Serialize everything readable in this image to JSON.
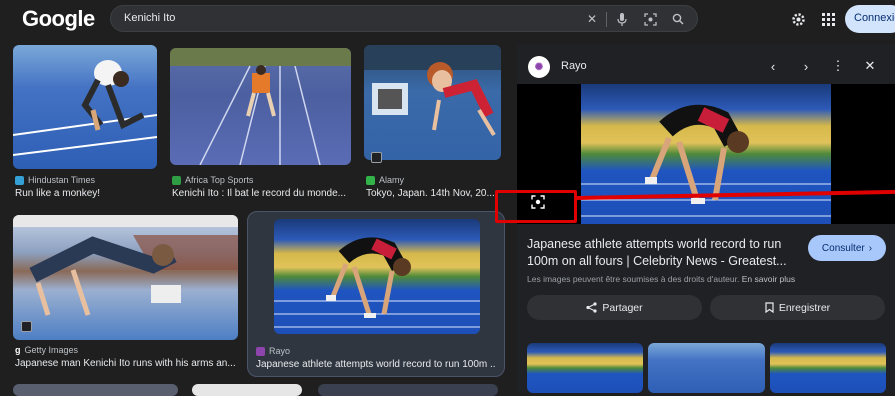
{
  "header": {
    "logo": "Google",
    "search_query": "Kenichi Ito",
    "connexion_label": "Connexio"
  },
  "results": [
    {
      "source": "Hindustan Times",
      "caption": "Run like a monkey!",
      "fav_color": "#34a0d6"
    },
    {
      "source": "Africa Top Sports",
      "caption": "Kenichi Ito : Il bat le record du monde...",
      "fav_color": "#2e9d44"
    },
    {
      "source": "Alamy",
      "caption": "Tokyo, Japan. 14th Nov, 20...",
      "fav_color": "#32b34a",
      "badge": "Story"
    },
    {
      "source": "Getty Images",
      "caption": "Japanese man Kenichi Ito runs with his arms an...",
      "fav_glyph": "g"
    },
    {
      "source": "Rayo",
      "caption": "Japanese athlete attempts world record to run 100m ...",
      "fav_color": "#8e44ad"
    }
  ],
  "panel": {
    "source_name": "Rayo",
    "title": "Japanese athlete attempts world record to run 100m on all fours | Celebrity News - Greatest...",
    "visit_label": "Consulter",
    "copyright_note": "Les images peuvent être soumises à des droits d'auteur.",
    "learn_more": "En savoir plus",
    "share_label": "Partager",
    "save_label": "Enregistrer"
  }
}
